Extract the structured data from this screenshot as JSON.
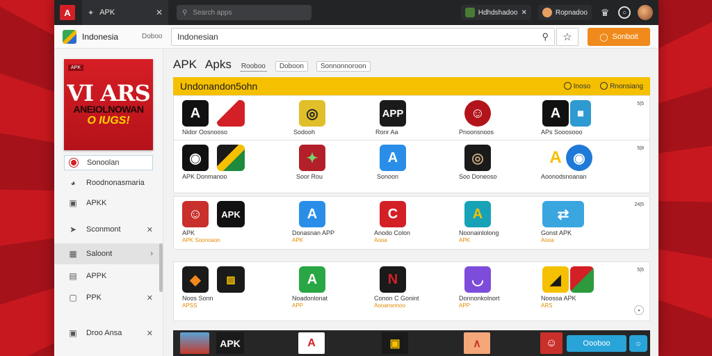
{
  "titlebar": {
    "tab_label": "APK",
    "tab_icon": "✦",
    "close": "✕",
    "url_placeholder": "Search apps",
    "ext1_label": "Hdhdshadoo",
    "ext2_label": "Ropnadoo"
  },
  "header": {
    "country": "Indonesia",
    "link": "Doboo",
    "search_value": "Indonesian",
    "signin_label": "Sonboit"
  },
  "promo": {
    "tag": "APK",
    "line1": "VI ARS",
    "line2": "ANEIOLNOWAN",
    "line3": "O IUGS!"
  },
  "sidebar": {
    "items": [
      {
        "label": "Sonoolan"
      },
      {
        "label": "Roodnonasmaria"
      },
      {
        "label": "APKK"
      },
      {
        "label": "Sconmont"
      },
      {
        "label": "Saloont"
      },
      {
        "label": "APPK"
      },
      {
        "label": "PPK"
      },
      {
        "label": "Droo Ansa"
      }
    ]
  },
  "main": {
    "title": "APK",
    "title2": "Apks",
    "subtab1": "Rooboo",
    "subtab2": "Doboon",
    "subtab3": "Sonnonnoroon",
    "banner_title": "Undonandon5ohn",
    "banner_right1": "Inoso",
    "banner_right2": "Rnonsiang",
    "rows": [
      {
        "meta": "5|5",
        "cells": [
          {
            "label": "Nidor Oosnooso",
            "sub": "",
            "glyph": "A"
          },
          {
            "label": "Sodooh",
            "sub": "",
            "glyph": "◎"
          },
          {
            "label": "Ronr Aa",
            "sub": "",
            "glyph": "APP"
          },
          {
            "label": "Pnoonsnoos",
            "sub": "",
            "glyph": "☺"
          },
          {
            "label": "APs Sooosooo",
            "sub": "",
            "glyph": "A"
          }
        ]
      },
      {
        "meta": "5|8",
        "cells": [
          {
            "label": "APK Donmanoo",
            "sub": "",
            "glyph": "◉"
          },
          {
            "label": "Soor Rou",
            "sub": "",
            "glyph": "✦"
          },
          {
            "label": "Sonoon",
            "sub": "",
            "glyph": "A"
          },
          {
            "label": "Soo Doneoso",
            "sub": "",
            "glyph": "◎"
          },
          {
            "label": "Aoonodsnoanan",
            "sub": "",
            "glyph": "A"
          }
        ]
      },
      {
        "meta": "24|5",
        "cells": [
          {
            "label": "APK",
            "sub": "APK Soonoaon",
            "glyph": "☺"
          },
          {
            "label": "Donasnan APP",
            "sub": "APK",
            "glyph": "A"
          },
          {
            "label": "Anodo Colon",
            "sub": "Aooa",
            "glyph": "C"
          },
          {
            "label": "Noonainlolong",
            "sub": "APK",
            "glyph": "A"
          },
          {
            "label": "Gonst APK",
            "sub": "Aooa",
            "glyph": "⇄"
          }
        ]
      },
      {
        "meta": "5|5",
        "cells": [
          {
            "label": "Noos Sonn",
            "sub": "APSS",
            "glyph": "◆"
          },
          {
            "label": "Noadonlonat",
            "sub": "APP",
            "glyph": "A"
          },
          {
            "label": "Conon C Gonint",
            "sub": "Aooansnnoo",
            "glyph": "N"
          },
          {
            "label": "Donnonkolnort",
            "sub": "APP",
            "glyph": "◡"
          },
          {
            "label": "Noossa APK",
            "sub": "ARS",
            "glyph": "◢"
          }
        ]
      }
    ]
  },
  "bottom": {
    "apk_text": "APK",
    "download_label": "Oooboo",
    "chat_icon": "chat-icon"
  },
  "colors": {
    "accent_orange": "#f08a1c",
    "banner_yellow": "#f5c000",
    "brand_red": "#d32027",
    "download_blue": "#29a4d9"
  }
}
